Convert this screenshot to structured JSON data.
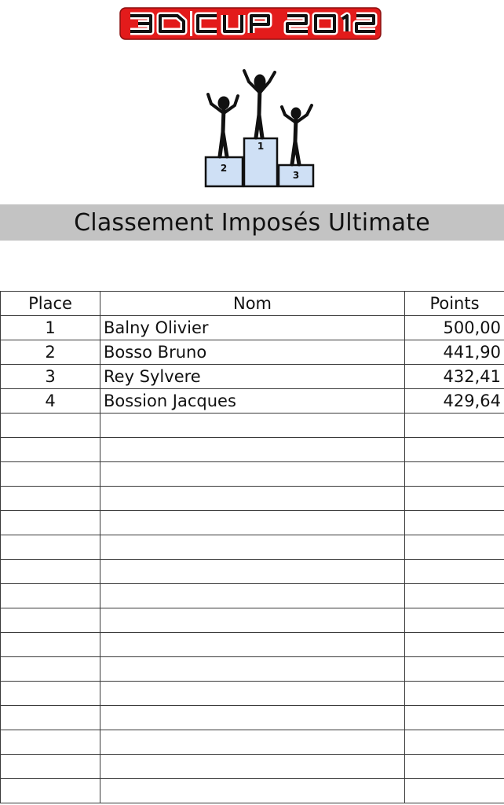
{
  "header": {
    "logo_text": "3D CUP 2012",
    "logo_colors": {
      "background": "#e31b1b",
      "text": "#111111",
      "outline": "#ffffff"
    },
    "podium_icon": "podium-winners-icon",
    "podium_places": [
      "2",
      "1",
      "3"
    ],
    "podium_color": "#cfe0f5"
  },
  "title": "Classement Imposés Ultimate",
  "table": {
    "columns": [
      "Place",
      "Nom",
      "Points"
    ],
    "rows": [
      [
        "1",
        "Balny Olivier",
        "500,00"
      ],
      [
        "2",
        "Bosso Bruno",
        "441,90"
      ],
      [
        "3",
        "Rey Sylvere",
        "432,41"
      ],
      [
        "4",
        "Bossion Jacques",
        "429,64"
      ]
    ],
    "empty_rows": 16
  }
}
